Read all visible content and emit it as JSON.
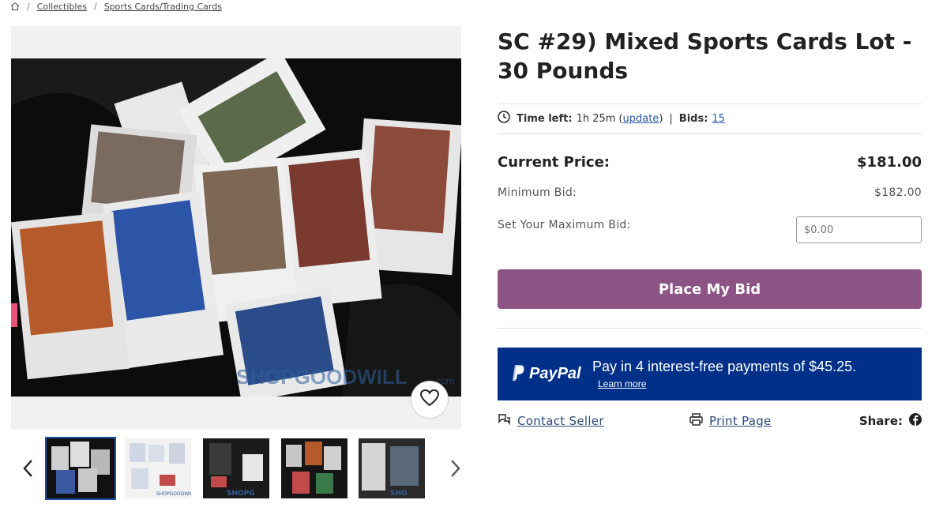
{
  "breadcrumb": {
    "items": [
      "Collectibles",
      "Sports Cards/Trading Cards"
    ]
  },
  "listing": {
    "title": "SC #29) Mixed Sports Cards Lot - 30 Pounds",
    "time_left_label": "Time left:",
    "time_left_value": "1h 25m",
    "update_open": "(",
    "update_link": "update",
    "update_close": ")",
    "separator": "|",
    "bids_label": "Bids:",
    "bids_count": "15"
  },
  "pricing": {
    "current_price_label": "Current Price:",
    "current_price_value": "$181.00",
    "minimum_bid_label": "Minimum Bid:",
    "minimum_bid_value": "$182.00",
    "max_bid_label": "Set Your Maximum Bid:",
    "max_bid_placeholder": "$0.00"
  },
  "bid_button": {
    "label": "Place My Bid"
  },
  "paypal": {
    "logo_text": "PayPal",
    "message": "Pay in 4 interest-free payments of $45.25.",
    "learn_more": "Learn more"
  },
  "actions": {
    "contact_seller": "Contact Seller",
    "print_page": "Print Page",
    "share_label": "Share:"
  },
  "gallery": {
    "watermark": "SHOPGOODWILL.COM",
    "thumbnails": [
      {
        "alt": "thumbnail-1",
        "active": true
      },
      {
        "alt": "thumbnail-2",
        "active": false
      },
      {
        "alt": "thumbnail-3",
        "active": false
      },
      {
        "alt": "thumbnail-4",
        "active": false
      },
      {
        "alt": "thumbnail-5",
        "active": false
      }
    ]
  },
  "colors": {
    "bid_button": "#8c5485",
    "paypal_bg": "#003087",
    "link": "#2b5aa5",
    "thumb_active_border": "#1e4f9c"
  }
}
